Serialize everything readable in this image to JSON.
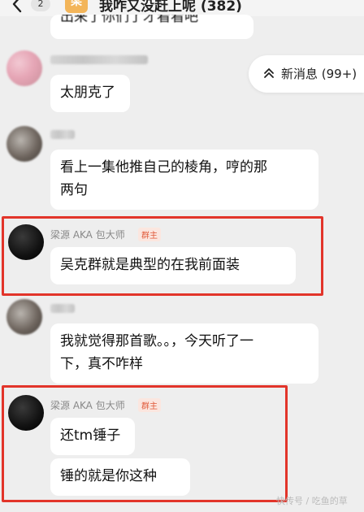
{
  "header": {
    "unread_count": "2",
    "avatar_char": "梁",
    "group_name": "我咋又没赶上呢",
    "member_count": "(382)"
  },
  "new_messages": {
    "label": "新消息 (99+)",
    "icon": "double-chevron-up-icon"
  },
  "messages": [
    {
      "sender": "",
      "text": "出来了你们了才看看吧"
    },
    {
      "sender": "",
      "text": "太朋克了"
    },
    {
      "sender": "",
      "lines": [
        "看上一集他推自己的棱角，哼的那",
        "两句"
      ]
    },
    {
      "sender": "梁源 AKA 包大师",
      "role": "群主",
      "text": "吴克群就是典型的在我前面装"
    },
    {
      "sender": "",
      "lines": [
        "我就觉得那首歌。。，今天听了一",
        "下，真不咋样"
      ]
    },
    {
      "sender": "梁源 AKA 包大师",
      "role": "群主",
      "texts": [
        "还tm锤子",
        "锤的就是你这种"
      ]
    }
  ],
  "watermark": "快传号 / 吃鱼的草",
  "colors": {
    "background": "#eeeeee",
    "bubble": "#ffffff",
    "highlight": "#e2342a",
    "group_avatar": "#f3b55a",
    "role_badge_text": "#e05a3a"
  }
}
